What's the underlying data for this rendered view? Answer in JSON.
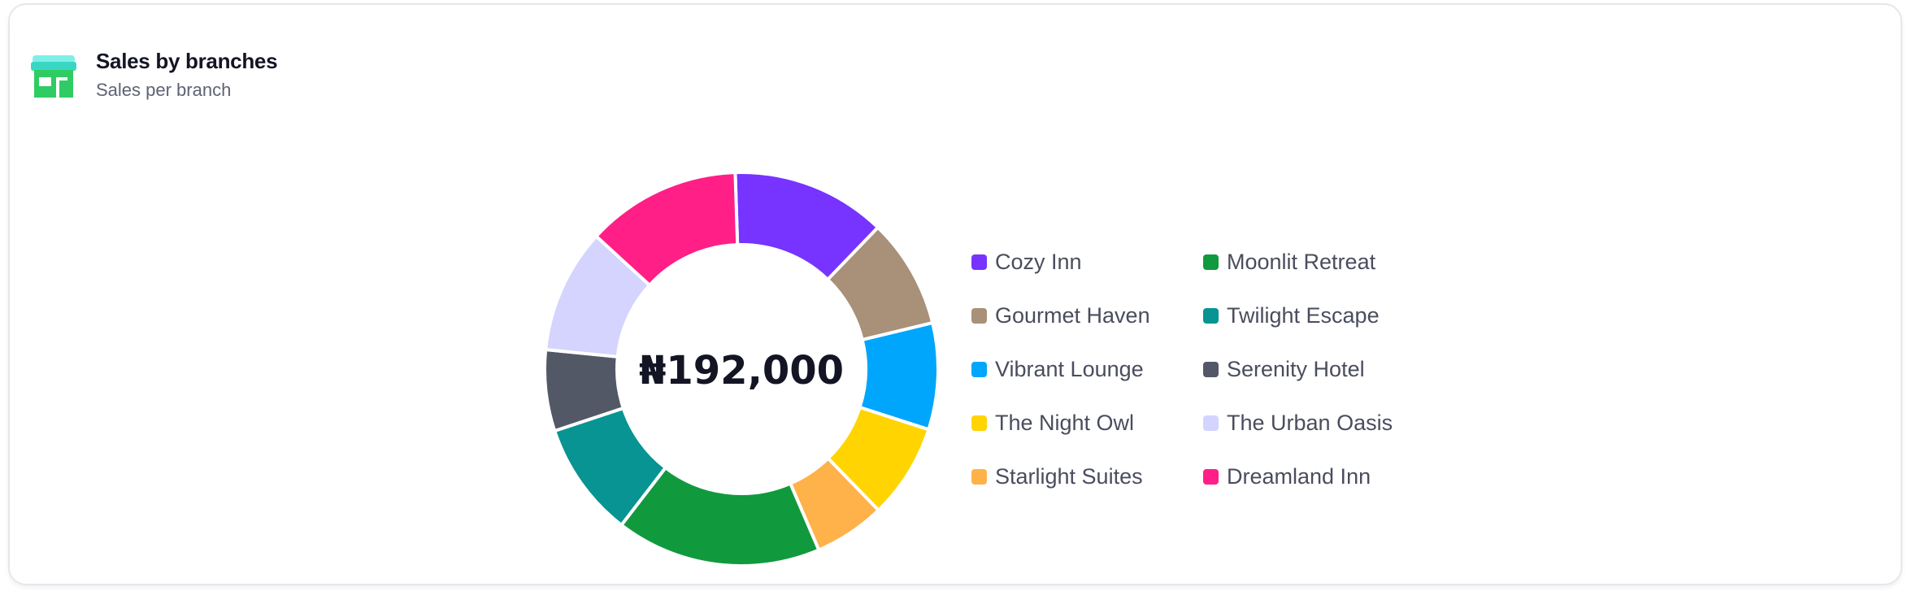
{
  "header": {
    "title": "Sales by branches",
    "subtitle": "Sales per branch",
    "icon": "store-icon"
  },
  "chart_data": {
    "type": "pie",
    "style": "donut",
    "center_label": "₦192,000",
    "legend_placement": "right",
    "categories": [
      "Cozy Inn",
      "Gourmet Haven",
      "Vibrant Lounge",
      "The Night Owl",
      "Starlight Suites",
      "Moonlit Retreat",
      "Twilight Escape",
      "Serenity Hotel",
      "The Urban Oasis",
      "Dreamland Inn"
    ],
    "values": [
      24400,
      17300,
      16800,
      14900,
      11200,
      32400,
      18200,
      12800,
      19600,
      24400
    ],
    "colors": [
      "#7733ff",
      "#a89079",
      "#00a6fb",
      "#ffd400",
      "#ffb14a",
      "#11993d",
      "#079492",
      "#525866",
      "#d4d4ff",
      "#ff1f87"
    ],
    "legend_columns": [
      [
        "Cozy Inn",
        "Gourmet Haven",
        "Vibrant Lounge",
        "The Night Owl",
        "Starlight Suites"
      ],
      [
        "Moonlit Retreat",
        "Twilight Escape",
        "Serenity Hotel",
        "The Urban Oasis",
        "Dreamland Inn"
      ]
    ]
  }
}
